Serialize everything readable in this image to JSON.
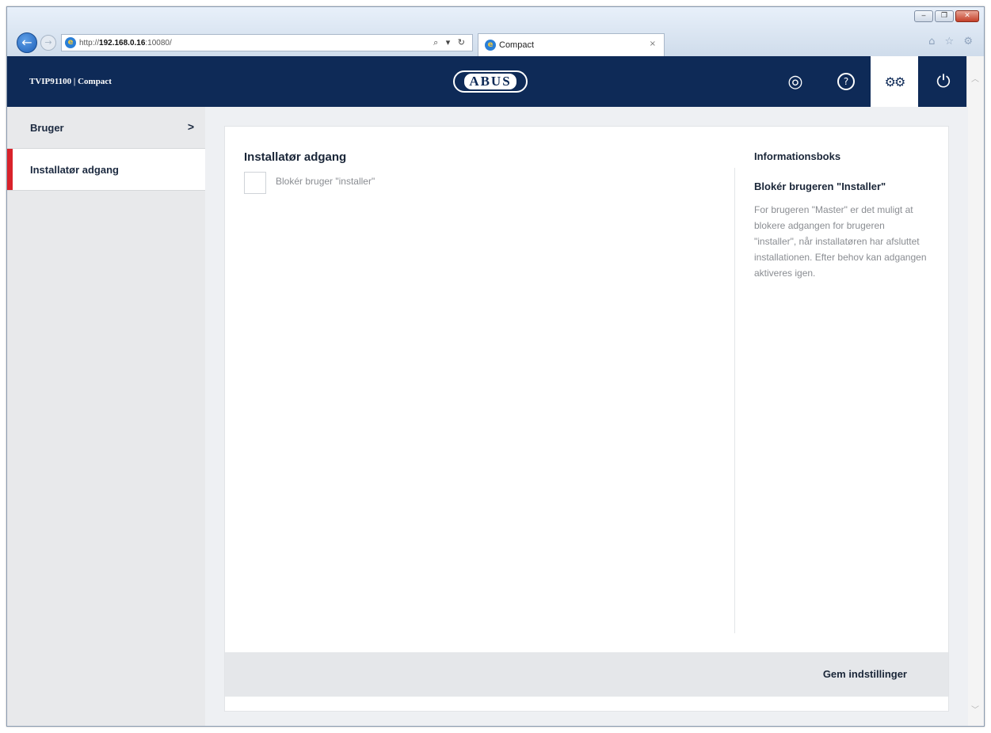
{
  "browser": {
    "url_prefix": "http://",
    "url_host": "192.168.0.16",
    "url_suffix": ":10080/",
    "address_tools": "⌕ ▾ ↻",
    "tab_title": "Compact",
    "tab_close": "×",
    "window_buttons": [
      "‒",
      "❐",
      "✕"
    ],
    "toolbar_icons": "⌂ ☆ ⚙"
  },
  "header": {
    "title": "TVIP91100 | Compact",
    "logo_text": "ABUS",
    "buttons": [
      {
        "icon": "camera-icon",
        "glyph": "◎"
      },
      {
        "icon": "help-icon",
        "glyph": "?"
      },
      {
        "icon": "settings-icon",
        "glyph": "⚙⚙"
      },
      {
        "icon": "power-icon",
        "glyph": "⏻"
      }
    ]
  },
  "sidebar": {
    "items": [
      {
        "label": "Bruger",
        "chevron": ">",
        "active": false
      },
      {
        "label": "Installatør adgang",
        "active": true
      }
    ]
  },
  "main": {
    "section_title": "Installatør adgang",
    "checkbox_label": "Blokér bruger \"installer\"",
    "checkbox_checked": false
  },
  "info": {
    "title": "Informationsboks",
    "heading": "Blokér brugeren \"Installer\"",
    "text": "For brugeren \"Master\" er det muligt at blokere adgangen for brugeren \"installer\", når installatøren har afsluttet installationen. Efter behov kan adgangen aktiveres igen."
  },
  "footer": {
    "save_label": "Gem indstillinger"
  },
  "colors": {
    "header_bg": "#0e2a57",
    "active_marker": "#d9222a",
    "sidebar_bg": "#e8e9eb"
  }
}
